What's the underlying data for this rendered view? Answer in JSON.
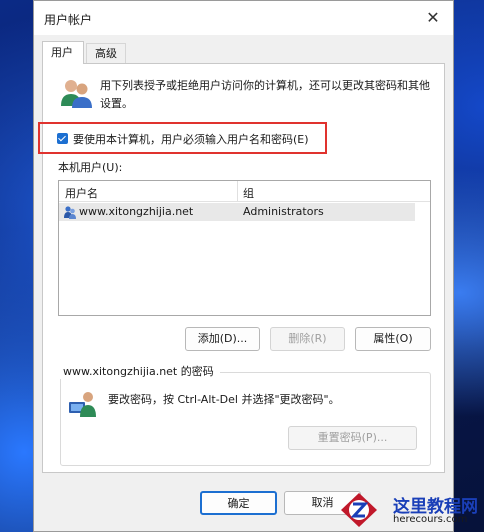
{
  "window": {
    "title": "用户帐户",
    "close_glyph": "✕"
  },
  "tabs": [
    {
      "label": "用户",
      "active": true
    },
    {
      "label": "高级",
      "active": false
    }
  ],
  "description": "用下列表授予或拒绝用户访问你的计算机，还可以更改其密码和其他设置。",
  "checkbox": {
    "label": "要使用本计算机，用户必须输入用户名和密码(E)",
    "checked": true
  },
  "local_users_label": "本机用户(U):",
  "list": {
    "columns": [
      "用户名",
      "组"
    ],
    "rows": [
      {
        "name": "www.xitongzhijia.net",
        "group": "Administrators"
      }
    ]
  },
  "buttons": {
    "add": "添加(D)...",
    "remove": "删除(R)",
    "properties": "属性(O)"
  },
  "password_group": {
    "title": "www.xitongzhijia.net 的密码",
    "text": "要改密码，按 Ctrl-Alt-Del 并选择\"更改密码\"。",
    "reset_button": "重置密码(P)..."
  },
  "footer": {
    "ok": "确定",
    "cancel": "取消"
  },
  "watermark": {
    "title": "这里教程网",
    "subtitle": "herecours.com"
  },
  "colors": {
    "accent": "#1c6fd1",
    "highlight_box": "#e0322e"
  }
}
